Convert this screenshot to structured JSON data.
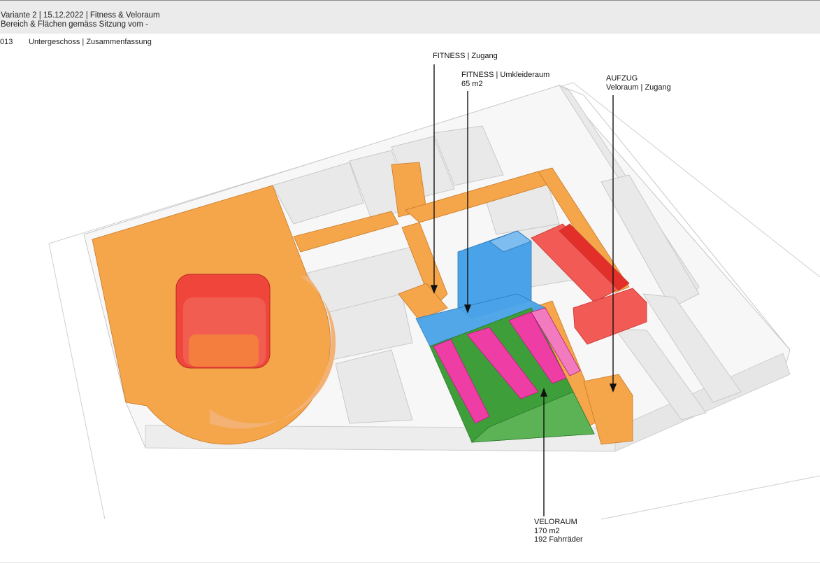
{
  "header": {
    "line1": "Variante 2 | 15.12.2022 | Fitness & Veloraum",
    "line2": "Bereich & Flächen gemäss Sitzung vom -"
  },
  "sheet": {
    "number": "013",
    "title": "Untergeschoss | Zusammenfassung"
  },
  "annotations": {
    "fitness_zugang": {
      "line1": "FITNESS | Zugang"
    },
    "fitness_umkleide": {
      "line1": "FITNESS | Umkleideraum",
      "line2": "65 m2"
    },
    "aufzug": {
      "line1": "AUFZUG",
      "line2": "Veloraum | Zugang"
    },
    "veloraum": {
      "line1": "VELORAUM",
      "line2": "170 m2",
      "line3": "192 Fahrräder"
    }
  },
  "colors": {
    "orange": "#f5a54a",
    "red": "#f0453a",
    "blue": "#4aa3e8",
    "green": "#3e9e3a",
    "magenta": "#ee3ea6",
    "wall": "#d9d9d9"
  }
}
